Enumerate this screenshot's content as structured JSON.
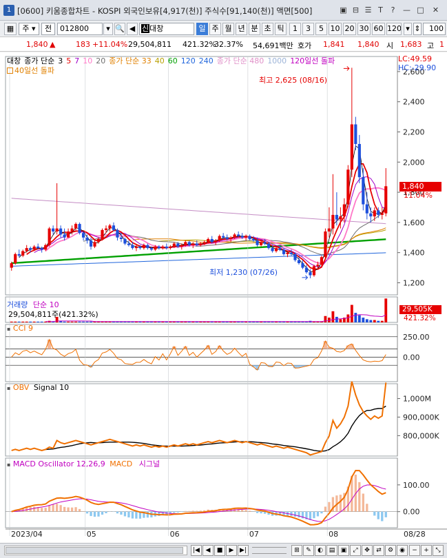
{
  "window": {
    "num": "1",
    "title": "[0600] 키움종합차트 - KOSPI 외국인보유[4,917(천)] 주식수[91,140(천)] 액면[500]",
    "controls": [
      "▣",
      "⊟",
      "☰",
      "T",
      "?",
      "—",
      "□",
      "✕"
    ]
  },
  "toolbar": {
    "market": "주",
    "prev": "전",
    "code": "012800",
    "name": "대창",
    "name_tag": "신",
    "periods": [
      "일",
      "주",
      "월",
      "년",
      "분",
      "초",
      "틱"
    ],
    "active_period": "일",
    "intervals": [
      "1",
      "3",
      "5",
      "10",
      "20",
      "30",
      "60",
      "120"
    ],
    "count": "100"
  },
  "quote": {
    "price": "1,840",
    "arrow": "▲",
    "change": "183",
    "change_pct": "+11.04%",
    "volume": "29,504,811",
    "vol_ratio": "421.32%",
    "turnover": "32.37%",
    "amount": "54,691백만",
    "ask_label": "호가",
    "ask": "1,841",
    "bid": "1,840",
    "open_label": "시",
    "open": "1,683",
    "high_label": "고",
    "high_partial": "1"
  },
  "legend": {
    "main_line1": [
      {
        "text": "대창",
        "color": "#000000"
      },
      {
        "text": "종가 단순",
        "color": "#000000"
      },
      {
        "text": "3",
        "color": "#000000"
      },
      {
        "text": "5",
        "color": "#e60000"
      },
      {
        "text": "7",
        "color": "#a000c8"
      },
      {
        "text": "10",
        "color": "#ff78c8"
      },
      {
        "text": "20",
        "color": "#6e6e6e"
      },
      {
        "text": "종가 단순 33",
        "color": "#e08000"
      },
      {
        "text": "40",
        "color": "#b8a000"
      },
      {
        "text": "60",
        "color": "#00a000"
      },
      {
        "text": "120",
        "color": "#1e64dc"
      },
      {
        "text": "240",
        "color": "#1e64dc"
      },
      {
        "text": "종가 단순 480",
        "color": "#e090c8"
      },
      {
        "text": "1000",
        "color": "#9cb4d8"
      },
      {
        "text": "120일선 돌파",
        "color": "#c000c0"
      }
    ],
    "main_line2": "40일선 돌파",
    "lc": "LC:49.59",
    "hc": "HC:-29.90"
  },
  "annotations": {
    "high": "최고 2,625 (08/16)",
    "low": "최저 1,230 (07/26)"
  },
  "price_badge": {
    "price": "1,840",
    "pct": "11.04%"
  },
  "panels": {
    "volume": {
      "title": "거래량",
      "ma": "단순 10",
      "value": "29,504,811주(421.32%)",
      "badge1": "29,505K",
      "badge2": "421.32%"
    },
    "cci": {
      "title": "CCI 9"
    },
    "obv": {
      "title": "OBV",
      "signal": "Signal 10"
    },
    "macd": {
      "title": "MACD Oscillator 12,26,9",
      "line": "MACD",
      "signal": "시그널"
    }
  },
  "x_labels": [
    "2023/04",
    "05",
    "06",
    "07",
    "08",
    "08/28"
  ],
  "colors": {
    "up": "#e60000",
    "down": "#1e50dc",
    "orange": "#f07000",
    "accent": "#3b7dd8"
  },
  "chart_data": [
    {
      "type": "candlestick",
      "title": "대창",
      "y_ticks": [
        "2,600",
        "2,400",
        "2,200",
        "2,000",
        "1,800",
        "1,600",
        "1,400",
        "1,200"
      ],
      "ylim": [
        1120,
        2700
      ],
      "candles": [
        [
          1300,
          1340,
          1280,
          1330
        ],
        [
          1330,
          1400,
          1320,
          1390
        ],
        [
          1390,
          1420,
          1370,
          1380
        ],
        [
          1380,
          1420,
          1370,
          1410
        ],
        [
          1410,
          1450,
          1400,
          1430
        ],
        [
          1430,
          1440,
          1400,
          1420
        ],
        [
          1420,
          1450,
          1410,
          1440
        ],
        [
          1440,
          1460,
          1420,
          1430
        ],
        [
          1430,
          1440,
          1400,
          1420
        ],
        [
          1420,
          1460,
          1410,
          1450
        ],
        [
          1450,
          1570,
          1440,
          1560
        ],
        [
          1560,
          1580,
          1520,
          1540
        ],
        [
          1540,
          1860,
          1520,
          1560
        ],
        [
          1560,
          1580,
          1500,
          1520
        ],
        [
          1520,
          1560,
          1480,
          1500
        ],
        [
          1500,
          1560,
          1500,
          1540
        ],
        [
          1540,
          1580,
          1520,
          1560
        ],
        [
          1560,
          1600,
          1540,
          1590
        ],
        [
          1590,
          1600,
          1520,
          1530
        ],
        [
          1530,
          1540,
          1480,
          1500
        ],
        [
          1500,
          1520,
          1460,
          1480
        ],
        [
          1480,
          1500,
          1420,
          1440
        ],
        [
          1440,
          1480,
          1430,
          1470
        ],
        [
          1470,
          1500,
          1460,
          1490
        ],
        [
          1490,
          1560,
          1480,
          1550
        ],
        [
          1550,
          1580,
          1530,
          1560
        ],
        [
          1560,
          1590,
          1540,
          1580
        ],
        [
          1580,
          1600,
          1540,
          1550
        ],
        [
          1550,
          1560,
          1480,
          1500
        ],
        [
          1500,
          1530,
          1470,
          1490
        ],
        [
          1490,
          1500,
          1450,
          1460
        ],
        [
          1460,
          1480,
          1440,
          1450
        ],
        [
          1450,
          1470,
          1420,
          1430
        ],
        [
          1430,
          1450,
          1410,
          1440
        ],
        [
          1440,
          1450,
          1420,
          1430
        ],
        [
          1430,
          1460,
          1420,
          1450
        ],
        [
          1450,
          1460,
          1420,
          1430
        ],
        [
          1430,
          1440,
          1410,
          1420
        ],
        [
          1420,
          1450,
          1410,
          1440
        ],
        [
          1440,
          1450,
          1420,
          1430
        ],
        [
          1430,
          1450,
          1420,
          1440
        ],
        [
          1440,
          1460,
          1420,
          1430
        ],
        [
          1430,
          1450,
          1420,
          1440
        ],
        [
          1440,
          1470,
          1430,
          1460
        ],
        [
          1460,
          1470,
          1430,
          1440
        ],
        [
          1440,
          1460,
          1420,
          1450
        ],
        [
          1450,
          1480,
          1440,
          1470
        ],
        [
          1470,
          1480,
          1440,
          1450
        ],
        [
          1450,
          1470,
          1430,
          1460
        ],
        [
          1460,
          1480,
          1440,
          1450
        ],
        [
          1450,
          1470,
          1440,
          1460
        ],
        [
          1460,
          1480,
          1450,
          1470
        ],
        [
          1470,
          1500,
          1460,
          1490
        ],
        [
          1490,
          1510,
          1460,
          1470
        ],
        [
          1470,
          1490,
          1450,
          1480
        ],
        [
          1480,
          1520,
          1470,
          1510
        ],
        [
          1510,
          1530,
          1490,
          1500
        ],
        [
          1500,
          1520,
          1480,
          1490
        ],
        [
          1490,
          1510,
          1470,
          1500
        ],
        [
          1500,
          1530,
          1490,
          1520
        ],
        [
          1520,
          1540,
          1500,
          1510
        ],
        [
          1510,
          1530,
          1490,
          1500
        ],
        [
          1500,
          1520,
          1480,
          1510
        ],
        [
          1510,
          1520,
          1480,
          1490
        ],
        [
          1490,
          1510,
          1470,
          1480
        ],
        [
          1480,
          1500,
          1440,
          1450
        ],
        [
          1450,
          1480,
          1440,
          1470
        ],
        [
          1470,
          1490,
          1450,
          1460
        ],
        [
          1460,
          1470,
          1420,
          1430
        ],
        [
          1430,
          1450,
          1400,
          1410
        ],
        [
          1410,
          1440,
          1400,
          1430
        ],
        [
          1430,
          1450,
          1410,
          1420
        ],
        [
          1420,
          1430,
          1380,
          1390
        ],
        [
          1390,
          1410,
          1370,
          1400
        ],
        [
          1400,
          1420,
          1380,
          1390
        ],
        [
          1390,
          1400,
          1340,
          1350
        ],
        [
          1350,
          1370,
          1320,
          1330
        ],
        [
          1330,
          1350,
          1290,
          1300
        ],
        [
          1300,
          1320,
          1260,
          1270
        ],
        [
          1270,
          1290,
          1230,
          1250
        ],
        [
          1250,
          1320,
          1240,
          1310
        ],
        [
          1310,
          1340,
          1290,
          1320
        ],
        [
          1320,
          1380,
          1300,
          1370
        ],
        [
          1370,
          1560,
          1360,
          1540
        ],
        [
          1540,
          1700,
          1500,
          1560
        ],
        [
          1560,
          1920,
          1520,
          1650
        ],
        [
          1650,
          1800,
          1580,
          1620
        ],
        [
          1620,
          1700,
          1560,
          1640
        ],
        [
          1640,
          1760,
          1600,
          1720
        ],
        [
          1720,
          1980,
          1700,
          1950
        ],
        [
          1950,
          2625,
          1900,
          2250
        ],
        [
          2250,
          2300,
          2080,
          2120
        ],
        [
          2120,
          2180,
          1860,
          1900
        ],
        [
          1900,
          1960,
          1680,
          1720
        ],
        [
          1720,
          1800,
          1620,
          1660
        ],
        [
          1660,
          1700,
          1600,
          1640
        ],
        [
          1640,
          1700,
          1610,
          1680
        ],
        [
          1680,
          1700,
          1630,
          1650
        ],
        [
          1650,
          1700,
          1620,
          1660
        ],
        [
          1660,
          1960,
          1640,
          1840
        ]
      ]
    },
    {
      "type": "bar",
      "title": "거래량",
      "series": [
        {
          "name": "거래량",
          "values": [
            1,
            1,
            1,
            1,
            1,
            1,
            1,
            1,
            1,
            1,
            2,
            1,
            7,
            2,
            1,
            1,
            1,
            1,
            1,
            1,
            1,
            1,
            1,
            1,
            1,
            1,
            1,
            1,
            1,
            1,
            1,
            1,
            1,
            1,
            1,
            1,
            1,
            1,
            1,
            1,
            1,
            1,
            1,
            1,
            1,
            1,
            1,
            1,
            1,
            1,
            1,
            1,
            1,
            1,
            1,
            1,
            1,
            1,
            1,
            1,
            1,
            1,
            1,
            1,
            1,
            1,
            1,
            1,
            1,
            1,
            1,
            1,
            1,
            1,
            1,
            1,
            1,
            1,
            1,
            2,
            1,
            1,
            1,
            8,
            6,
            14,
            7,
            4,
            6,
            10,
            22,
            12,
            9,
            6,
            4,
            3,
            3,
            2,
            2,
            30
          ]
        }
      ]
    },
    {
      "type": "area",
      "title": "CCI 9",
      "y_ticks": [
        "250.00",
        "0.00"
      ],
      "ylim": [
        -300,
        400
      ]
    },
    {
      "type": "line",
      "title": "OBV",
      "y_ticks": [
        "1,000M",
        "900,000K",
        "800,000K"
      ],
      "ylim": [
        690,
        1080
      ]
    },
    {
      "type": "bar",
      "title": "MACD Oscillator 12,26,9",
      "y_ticks": [
        "100.00",
        "0.00"
      ],
      "ylim": [
        -60,
        200
      ]
    }
  ]
}
